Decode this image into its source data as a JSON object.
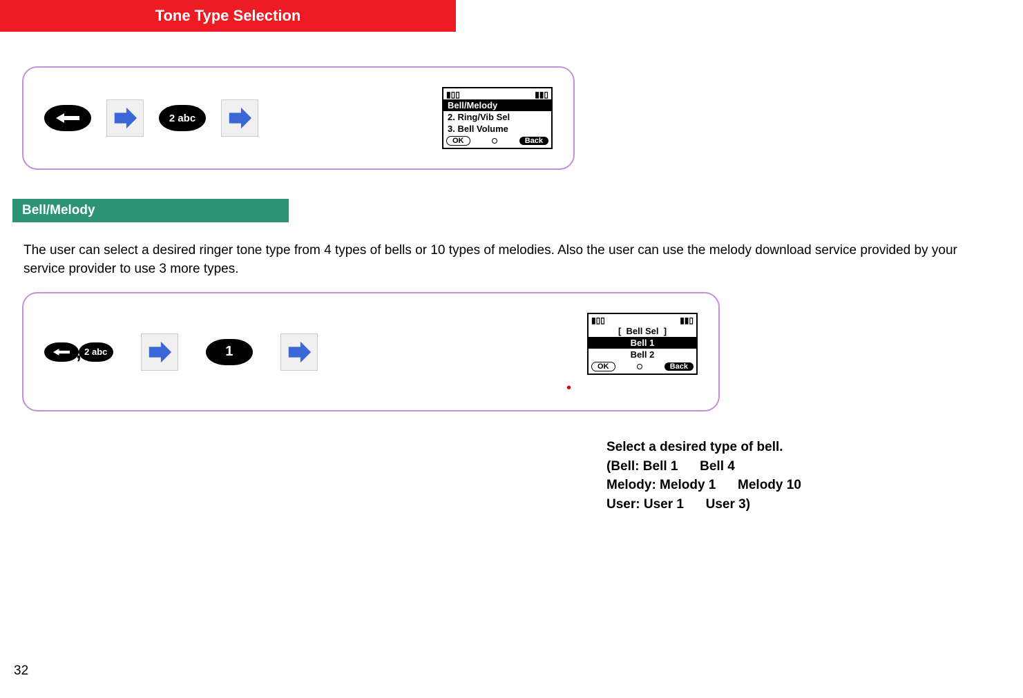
{
  "header": {
    "title": "Tone Type Selection"
  },
  "subheader": {
    "title": "Bell/Melody"
  },
  "intro_text": "The user can select a desired ringer tone type from 4 types of bells or 10 types of melodies. Also the user can use the melody download service provided by your service provider to use 3 more types.",
  "diagram1": {
    "pebble1_label": "",
    "key2_label": "2 abc",
    "screen": {
      "row1": "Bell/Melody",
      "row2_num": "2.",
      "row2_text": "Ring/Vib Sel",
      "row3_num": "3.",
      "row3_text": "Bell Volume",
      "ok": "OK",
      "back": "Back"
    }
  },
  "diagram2": {
    "key2_label": "2 abc",
    "key1_label": "1",
    "screen": {
      "header": "Bell Sel",
      "row1": "Bell 1",
      "row2": "Bell 2",
      "ok": "OK",
      "back": "Back"
    }
  },
  "instructions": {
    "line1": "Select a desired type of bell.",
    "line2": "(Bell: Bell 1      Bell 4",
    "line3": "Melody: Melody 1      Melody 10",
    "line4": "User: User 1      User 3)"
  },
  "page_number": "32"
}
